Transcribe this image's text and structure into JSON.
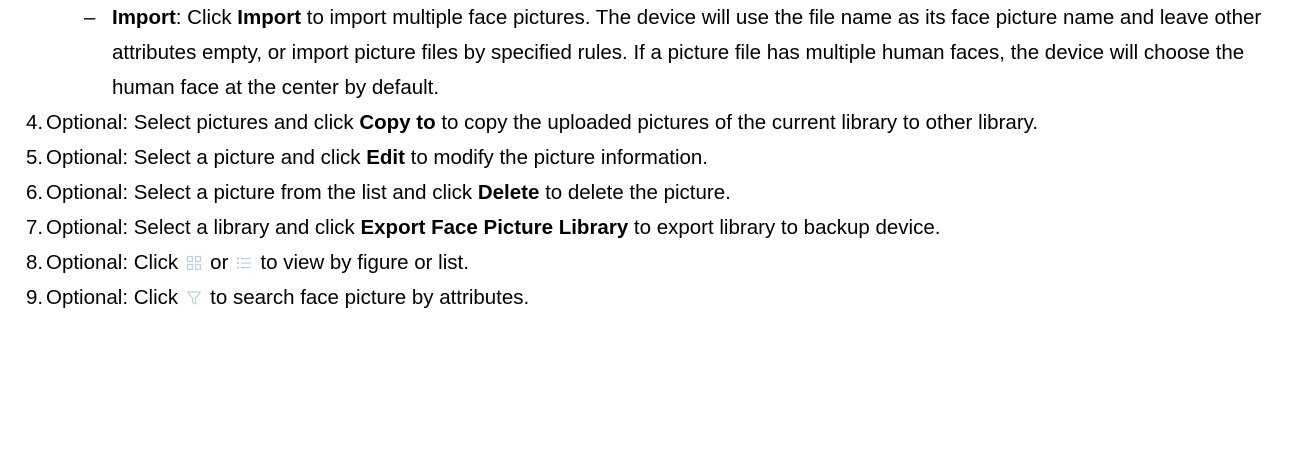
{
  "import_item": {
    "dash": "–",
    "term": "Import",
    "t1": ": Click ",
    "term2": "Import",
    "t2": " to import multiple face pictures. The device will use the file name as its face picture name and leave other attributes empty, or import picture files by specified rules. If a picture file has multiple human faces, the device will choose the human face at the center by default."
  },
  "steps": [
    {
      "num": "4.",
      "pre": "Optional: Select pictures and click ",
      "bold": "Copy to",
      "post": " to copy the uploaded pictures of the current library to other library."
    },
    {
      "num": "5.",
      "pre": "Optional: Select a picture and click ",
      "bold": "Edit",
      "post": " to modify the picture information."
    },
    {
      "num": "6.",
      "pre": "Optional: Select a picture from the list and click ",
      "bold": "Delete",
      "post": " to delete the picture."
    },
    {
      "num": "7.",
      "pre": "Optional: Select a library and click ",
      "bold": "Export Face Picture Library",
      "post": " to export library to backup device."
    }
  ],
  "step8": {
    "num": "8.",
    "pre": "Optional: Click",
    "mid": "or",
    "post": "to view by figure or list."
  },
  "step9": {
    "num": "9.",
    "pre": "Optional: Click",
    "post": "to search face picture by attributes."
  },
  "icons": {
    "figure_view": "grid-view-icon",
    "list_view": "list-view-icon",
    "filter": "filter-icon",
    "icon_color": "#b8d2ea"
  }
}
